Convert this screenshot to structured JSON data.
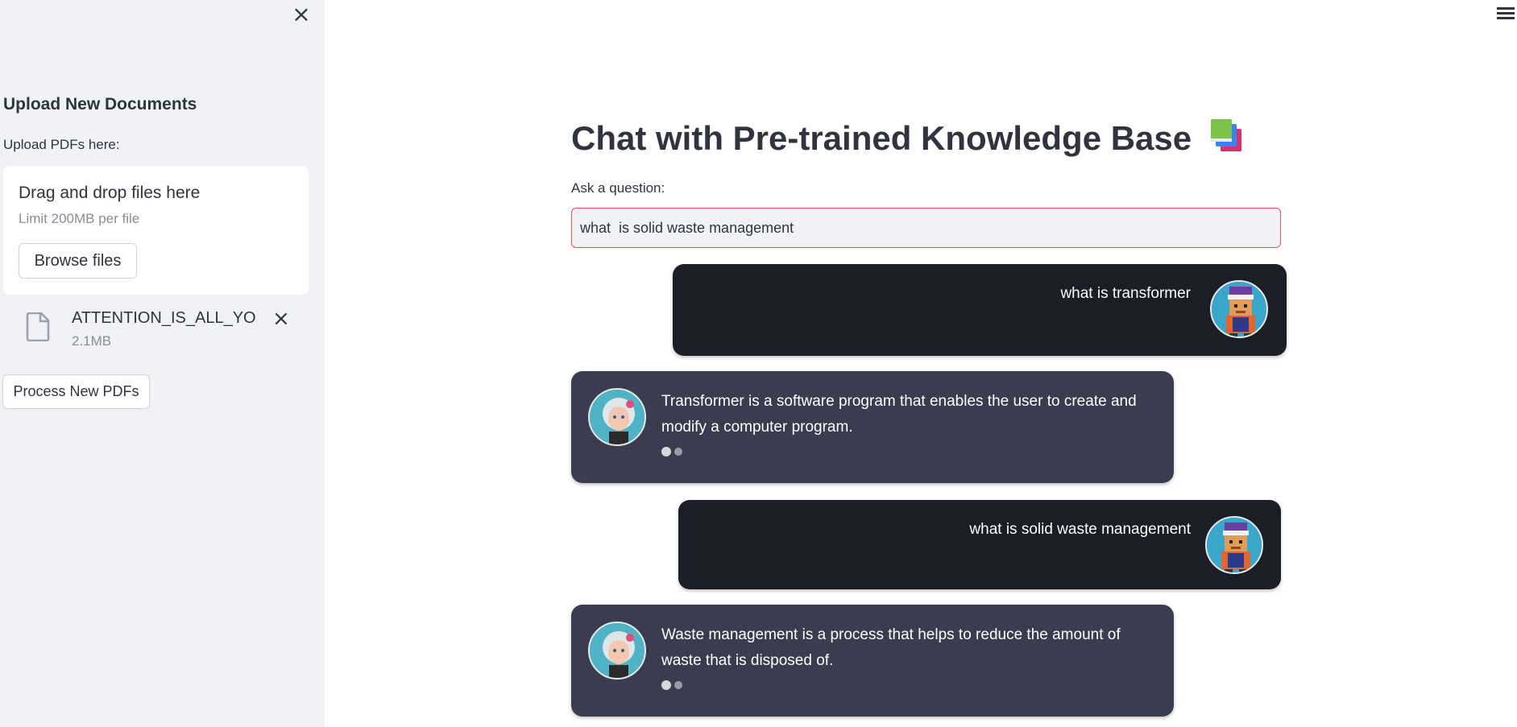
{
  "sidebar": {
    "close_icon": "×",
    "title": "Upload New Documents",
    "upload_label": "Upload PDFs here:",
    "dropzone": {
      "title": "Drag and drop files here",
      "limit": "Limit 200MB per file",
      "browse_label": "Browse files"
    },
    "file": {
      "name": "ATTENTION_IS_ALL_YO...",
      "size": "2.1MB",
      "remove_icon": "×"
    },
    "process_label": "Process New PDFs"
  },
  "main": {
    "title": "Chat with Pre-trained Knowledge Base",
    "title_icon": "books-icon",
    "ask_label": "Ask a question:",
    "question_value": "what  is solid waste management"
  },
  "messages": [
    {
      "role": "user",
      "text": "what is transformer"
    },
    {
      "role": "bot",
      "text": "Transformer is a software program that enables the user to create and modify a computer program."
    },
    {
      "role": "user",
      "text": "what is solid waste management"
    },
    {
      "role": "bot",
      "text": "Waste management is a process that helps to reduce the amount of waste that is disposed of."
    }
  ],
  "colors": {
    "accent": "#ff4b4b",
    "sidebar_bg": "#f0f2f6",
    "user_bubble": "#1b1e27",
    "bot_bubble": "#393d4f"
  }
}
